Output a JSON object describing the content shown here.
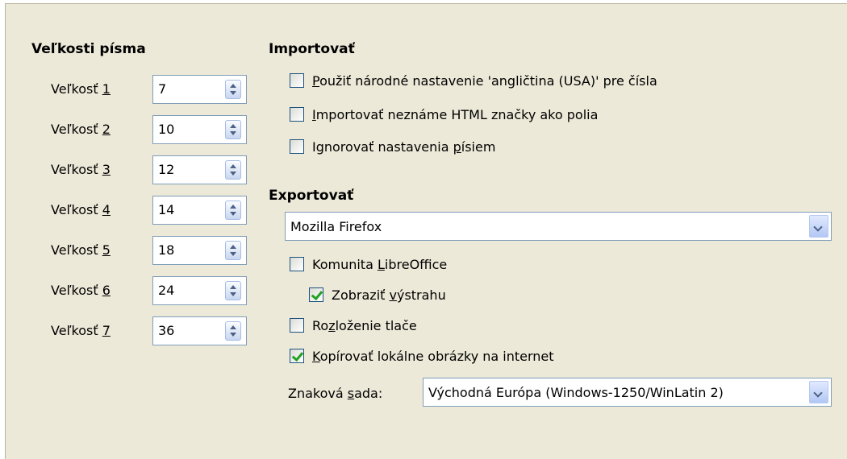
{
  "font_sizes": {
    "heading": "Veľkosti písma",
    "rows": [
      {
        "label_pre": "Veľkosť ",
        "label_key": "1",
        "value": "7"
      },
      {
        "label_pre": "Veľkosť ",
        "label_key": "2",
        "value": "10"
      },
      {
        "label_pre": "Veľkosť ",
        "label_key": "3",
        "value": "12"
      },
      {
        "label_pre": "Veľkosť ",
        "label_key": "4",
        "value": "14"
      },
      {
        "label_pre": "Veľkosť ",
        "label_key": "5",
        "value": "18"
      },
      {
        "label_pre": "Veľkosť ",
        "label_key": "6",
        "value": "24"
      },
      {
        "label_pre": "Veľkosť ",
        "label_key": "7",
        "value": "36"
      }
    ]
  },
  "import": {
    "heading": "Importovať",
    "options": [
      {
        "key": "P",
        "rest": "oužiť národné nastavenie 'angličtina (USA)' pre čísla",
        "checked": false
      },
      {
        "key": "I",
        "rest": "mportovať neznáme HTML značky ako polia",
        "checked": false
      },
      {
        "pre": "Ignorovať nastavenia ",
        "key": "p",
        "rest": "ísiem",
        "checked": false
      }
    ]
  },
  "export": {
    "heading": "Exportovať",
    "browser": "Mozilla Firefox",
    "libreoffice": {
      "pre": "Komunita ",
      "key": "L",
      "rest": "ibreOffice",
      "checked": false
    },
    "show_warning": {
      "pre": "Zobraziť ",
      "key": "v",
      "rest": "ýstrahu",
      "checked": true
    },
    "print_layout": {
      "pre": "Ro",
      "key": "z",
      "rest": "loženie tlače",
      "checked": false
    },
    "copy_images": {
      "key": "K",
      "rest": "opírovať lokálne obrázky na internet",
      "checked": true
    },
    "charset_label_pre": "Znaková ",
    "charset_label_key": "s",
    "charset_label_rest": "ada:",
    "charset_value": "Východná Európa (Windows-1250/WinLatin 2)"
  }
}
